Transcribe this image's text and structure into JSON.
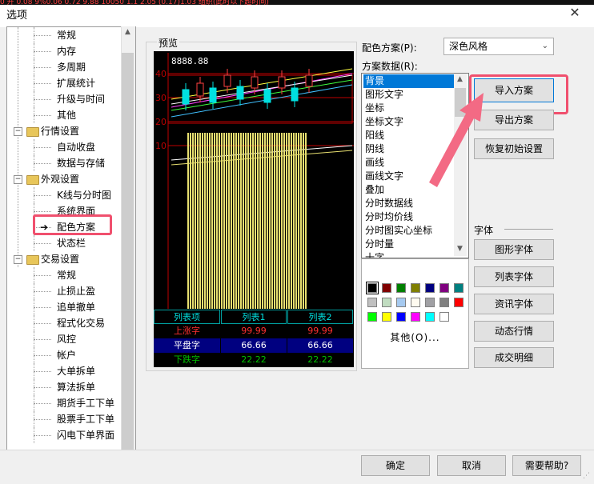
{
  "window": {
    "title": "选项",
    "close_glyph": "✕",
    "bg_ticker": "0 开 0.08  9%0.06  0.72  9.88  10050  1.1  2.05  (0.17)1.03  组织(此时以下超时间)"
  },
  "tree": {
    "items": [
      {
        "label": "常规",
        "level": 1
      },
      {
        "label": "内存",
        "level": 1
      },
      {
        "label": "多周期",
        "level": 1
      },
      {
        "label": "扩展统计",
        "level": 1
      },
      {
        "label": "升级与时间",
        "level": 1
      },
      {
        "label": "其他",
        "level": 1
      },
      {
        "label": "行情设置",
        "level": 0,
        "expander": "−"
      },
      {
        "label": "自动收盘",
        "level": 1
      },
      {
        "label": "数据与存储",
        "level": 1
      },
      {
        "label": "外观设置",
        "level": 0,
        "expander": "−"
      },
      {
        "label": "K线与分时图",
        "level": 1
      },
      {
        "label": "系统界面",
        "level": 1
      },
      {
        "label": "配色方案",
        "level": 1,
        "selected": true
      },
      {
        "label": "状态栏",
        "level": 1
      },
      {
        "label": "交易设置",
        "level": 0,
        "expander": "−"
      },
      {
        "label": "常规",
        "level": 1
      },
      {
        "label": "止损止盈",
        "level": 1
      },
      {
        "label": "追单撤单",
        "level": 1
      },
      {
        "label": "程式化交易",
        "level": 1
      },
      {
        "label": "风控",
        "level": 1
      },
      {
        "label": "帐户",
        "level": 1
      },
      {
        "label": "大单拆单",
        "level": 1
      },
      {
        "label": "算法拆单",
        "level": 1
      },
      {
        "label": "期货手工下单",
        "level": 1
      },
      {
        "label": "股票手工下单",
        "level": 1
      },
      {
        "label": "闪电下单界面",
        "level": 1
      }
    ],
    "pointer_glyph": "➔",
    "scroll_up": "▲",
    "scroll_down": "▼"
  },
  "preview": {
    "label": "预览",
    "price_readout": "8888.88",
    "axis_labels": [
      "40",
      "30",
      "20",
      "10"
    ],
    "table": {
      "headers": [
        "列表项",
        "列表1",
        "列表2"
      ],
      "rows": [
        {
          "name": "上涨字",
          "v1": "99.99",
          "v2": "99.99",
          "color": "#ff3030",
          "bg": "#000000"
        },
        {
          "name": "平盘字",
          "v1": "66.66",
          "v2": "66.66",
          "color": "#ffffff",
          "bg": "#000080"
        },
        {
          "name": "下跌字",
          "v1": "22.22",
          "v2": "22.22",
          "color": "#00c000",
          "bg": "#000000"
        }
      ],
      "header_color": "#00e0e0"
    },
    "colors": {
      "grid": "#c00000",
      "volume": "#e8e070",
      "candle_up": "#ff4040",
      "candle_down": "#00e0e0",
      "readout": "#ffffff"
    }
  },
  "scheme": {
    "label": "配色方案(P):",
    "selected": "深色风格",
    "arrow": "⌄"
  },
  "scheme_data": {
    "label": "方案数据(R):",
    "items": [
      "背景",
      "图形文字",
      "坐标",
      "坐标文字",
      "阳线",
      "阴线",
      "画线",
      "画线文字",
      "叠加",
      "分时数据线",
      "分时均价线",
      "分时图实心坐标",
      "分时量",
      "十字"
    ],
    "selected_index": 0,
    "scroll_up": "▲",
    "scroll_down": "▼"
  },
  "palette": {
    "swatches": [
      "#000000",
      "#800000",
      "#008000",
      "#808000",
      "#000080",
      "#800080",
      "#008080",
      "#c0c0c0",
      "#c0dcc0",
      "#a6caf0",
      "#fffbf0",
      "#a0a0a4",
      "#808080",
      "#ff0000",
      "#00ff00",
      "#ffff00",
      "#0000ff",
      "#ff00ff",
      "#00ffff",
      "#ffffff"
    ],
    "other_label": "其他(O)..."
  },
  "buttons": {
    "import": "导入方案",
    "export": "导出方案",
    "reset": "恢复初始设置",
    "font_section": "字体",
    "graph_font": "图形字体",
    "list_font": "列表字体",
    "info_font": "资讯字体",
    "dynamic_quote": "动态行情",
    "trade_detail": "成交明细",
    "ok": "确定",
    "cancel": "取消",
    "help": "需要帮助?"
  }
}
